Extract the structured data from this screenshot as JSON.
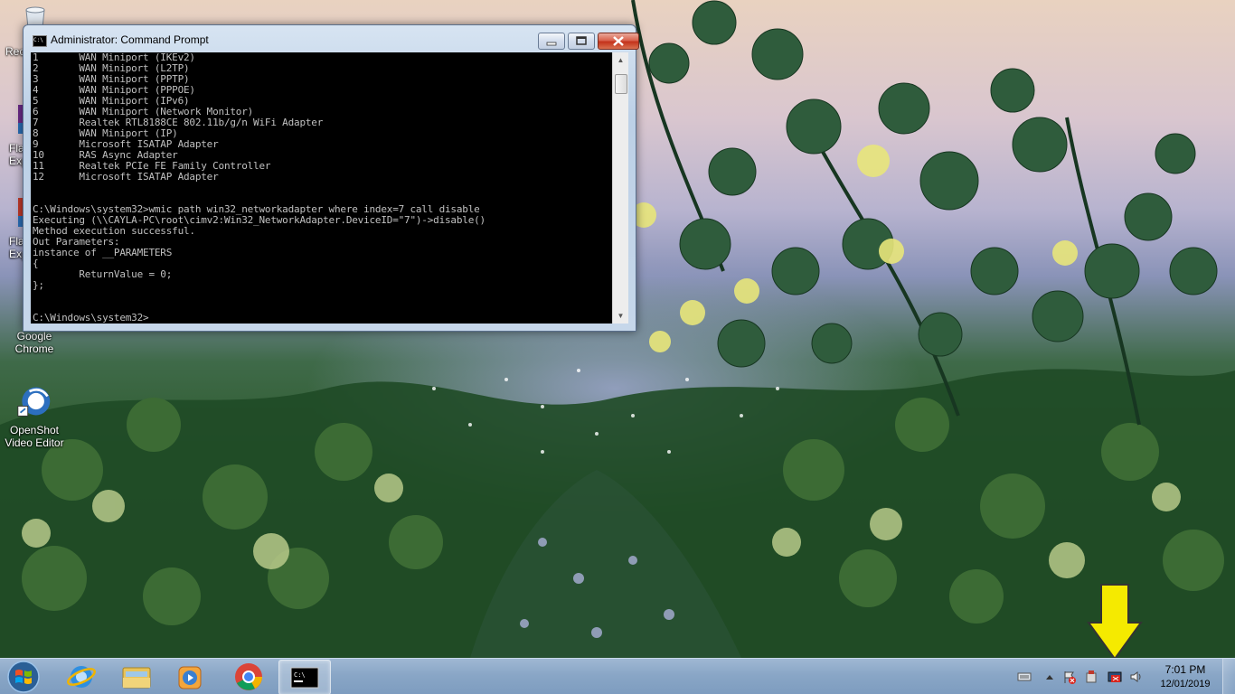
{
  "window": {
    "title": "Administrator: Command Prompt",
    "icon": "cmd-icon",
    "console_lines": [
      "1       WAN Miniport (IKEv2)",
      "2       WAN Miniport (L2TP)",
      "3       WAN Miniport (PPTP)",
      "4       WAN Miniport (PPPOE)",
      "5       WAN Miniport (IPv6)",
      "6       WAN Miniport (Network Monitor)",
      "7       Realtek RTL8188CE 802.11b/g/n WiFi Adapter",
      "8       WAN Miniport (IP)",
      "9       Microsoft ISATAP Adapter",
      "10      RAS Async Adapter",
      "11      Realtek PCIe FE Family Controller",
      "12      Microsoft ISATAP Adapter",
      "",
      "",
      "C:\\Windows\\system32>wmic path win32_networkadapter where index=7 call disable",
      "Executing (\\\\CAYLA-PC\\root\\cimv2:Win32_NetworkAdapter.DeviceID=\"7\")->disable()",
      "Method execution successful.",
      "Out Parameters:",
      "instance of __PARAMETERS",
      "{",
      "        ReturnValue = 0;",
      "};",
      "",
      "",
      "C:\\Windows\\system32>"
    ]
  },
  "desktop_icons": [
    {
      "label": "Rec",
      "icon": "recycle-bin-icon"
    },
    {
      "label": "Fla\nExp",
      "icon": "flash-icon"
    },
    {
      "label": "Fla\nExp",
      "icon": "flash-icon"
    },
    {
      "label": "Google\nChrome",
      "icon": "chrome-icon"
    },
    {
      "label": "OpenShot\nVideo Editor",
      "icon": "openshot-icon"
    }
  ],
  "taskbar": {
    "apps": [
      {
        "name": "Internet Explorer",
        "icon": "ie-icon"
      },
      {
        "name": "Windows Explorer",
        "icon": "folder-icon"
      },
      {
        "name": "Windows Media Player",
        "icon": "media-player-icon"
      },
      {
        "name": "Google Chrome",
        "icon": "chrome-icon"
      },
      {
        "name": "Command Prompt",
        "icon": "cmd-icon"
      }
    ],
    "clock_time": "7:01 PM",
    "clock_date": "12/01/2019"
  },
  "colors": {
    "console_bg": "#000000",
    "console_fg": "#c0c0c0",
    "arrow": "#f5ea00"
  }
}
